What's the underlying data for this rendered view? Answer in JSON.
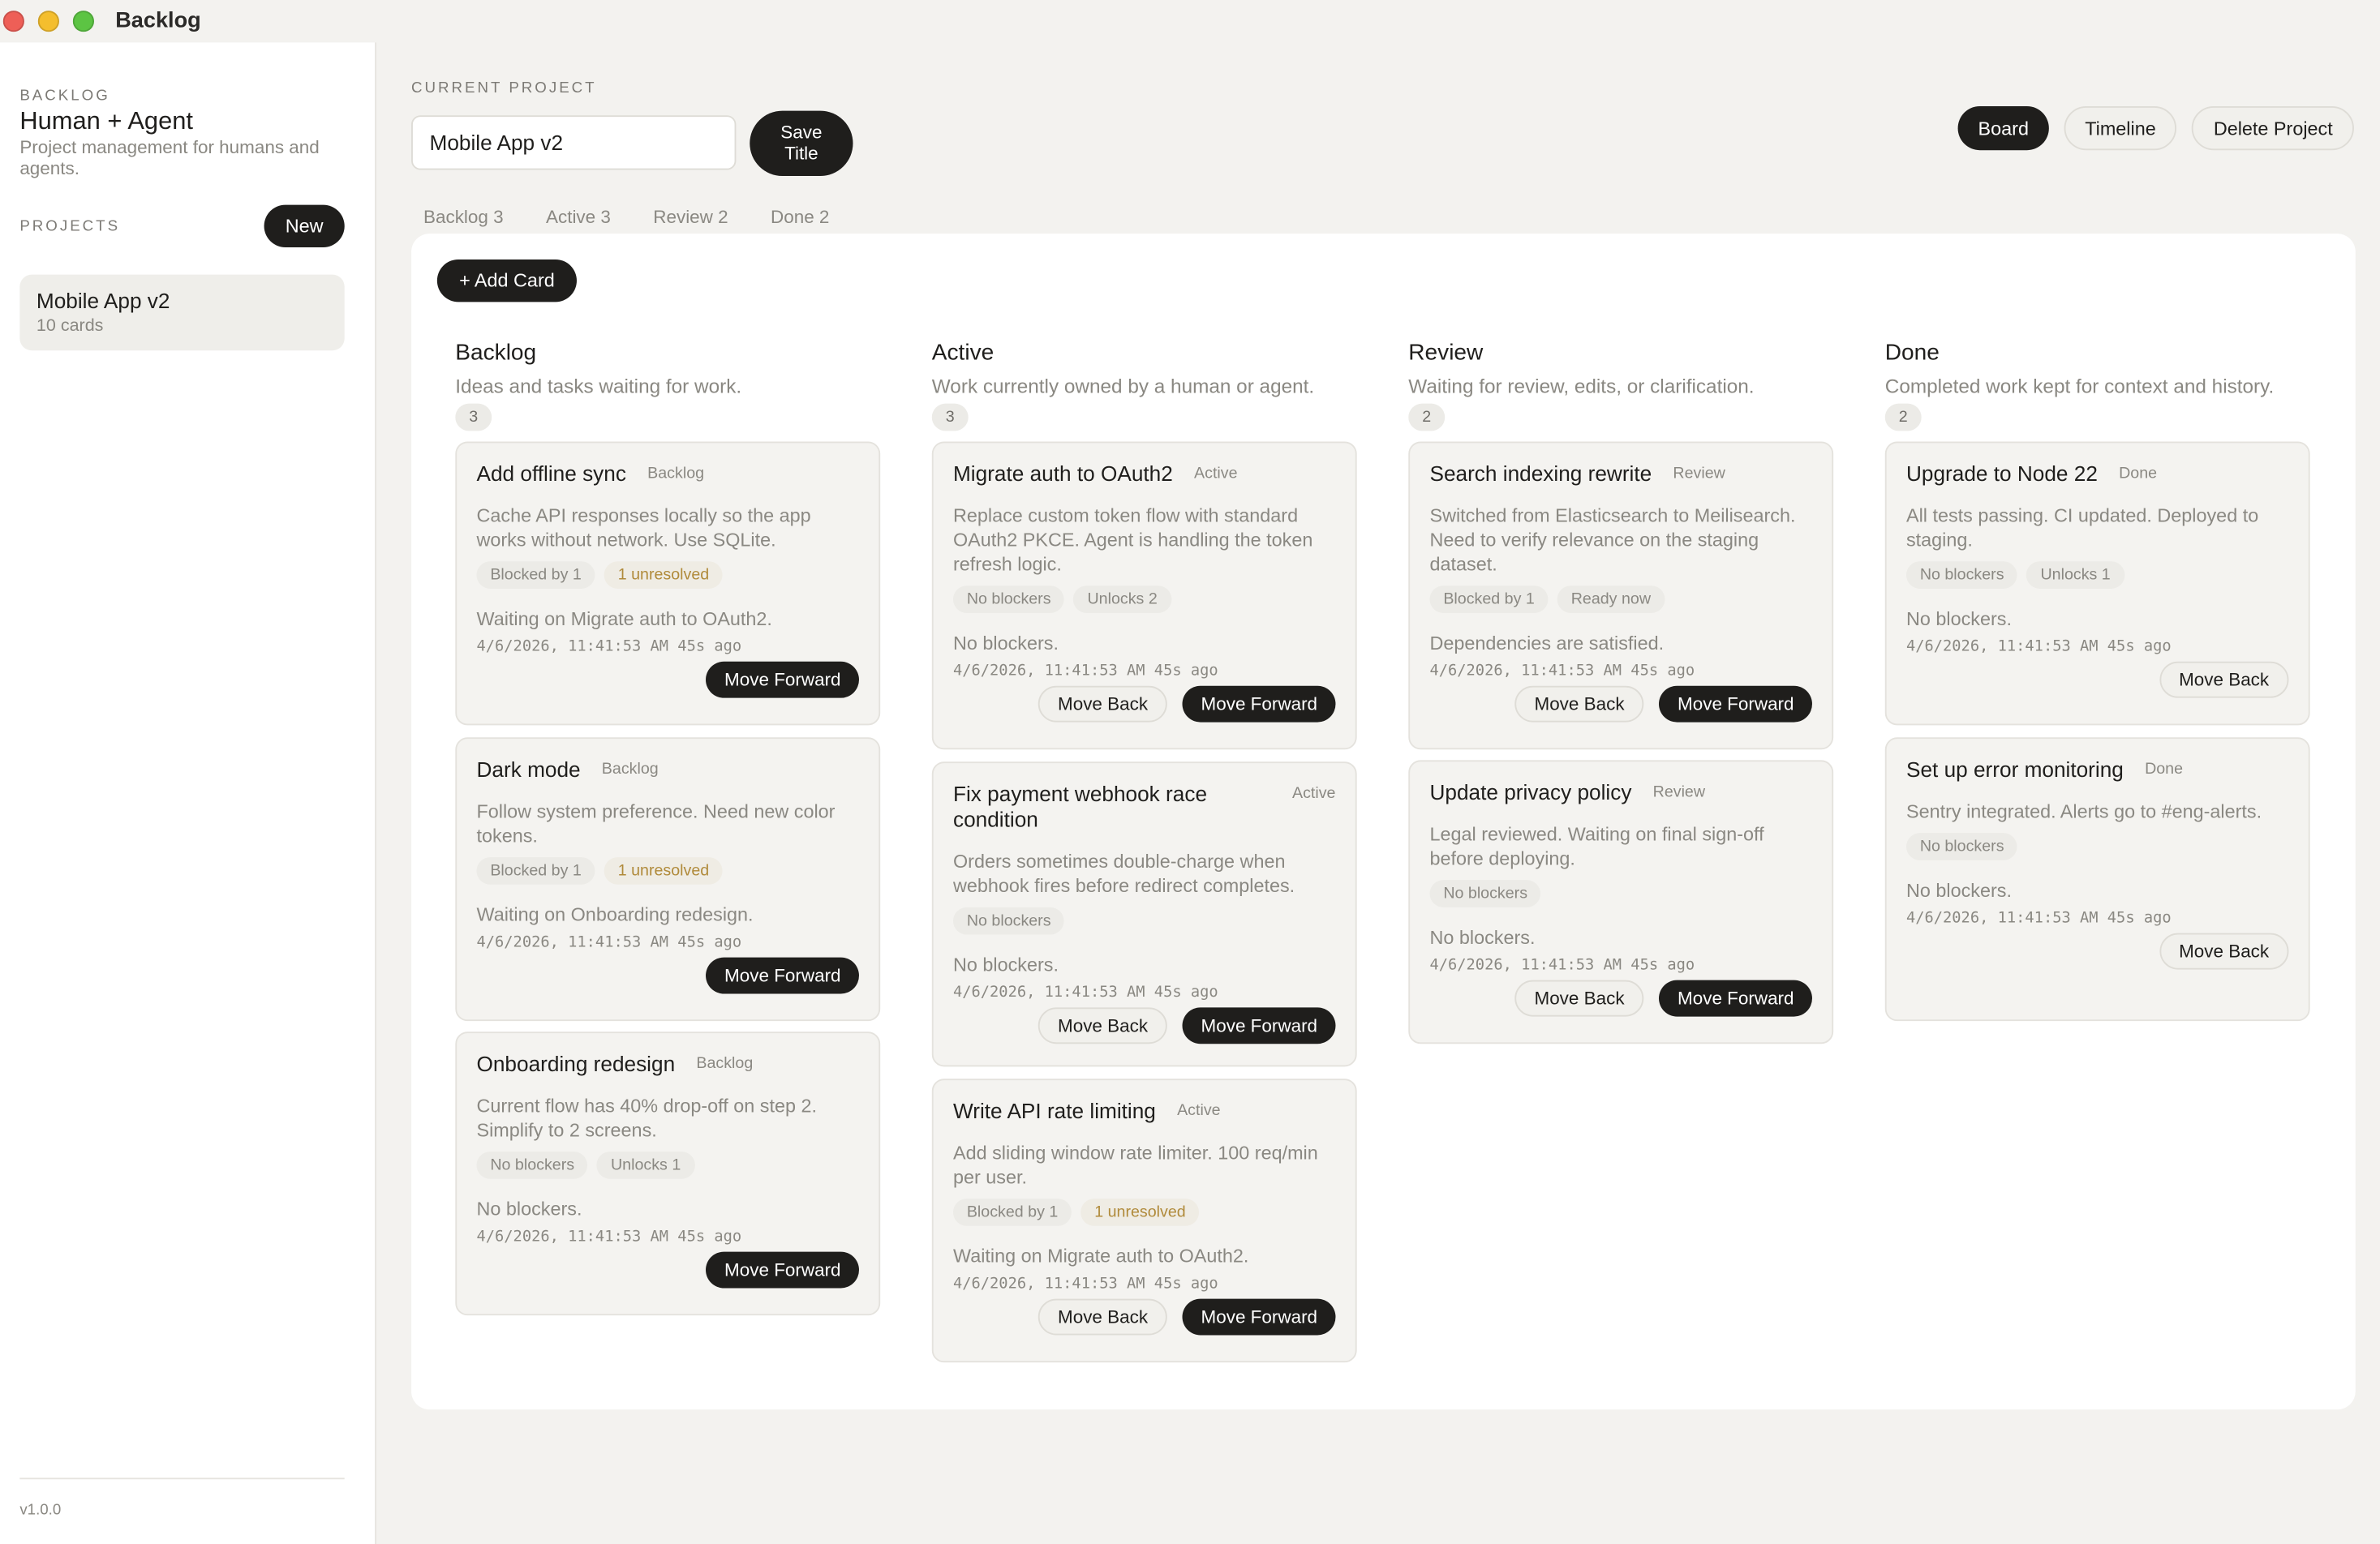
{
  "window": {
    "title": "Backlog"
  },
  "sidebar": {
    "kicker": "BACKLOG",
    "app_name": "Human + Agent",
    "description": "Project management for humans and agents.",
    "projects_label": "PROJECTS",
    "new_label": "New",
    "projects": [
      {
        "name": "Mobile App v2",
        "count": "10 cards"
      }
    ],
    "version": "v1.0.0"
  },
  "header": {
    "current_project_label": "CURRENT PROJECT",
    "title_value": "Mobile App v2",
    "save_label": "Save Title",
    "view_buttons": {
      "board": "Board",
      "timeline": "Timeline",
      "delete": "Delete Project"
    }
  },
  "tabs": [
    {
      "label": "Backlog 3"
    },
    {
      "label": "Active 3"
    },
    {
      "label": "Review 2"
    },
    {
      "label": "Done 2"
    }
  ],
  "board": {
    "add_card_label": "+ Add Card",
    "columns": [
      {
        "title": "Backlog",
        "description": "Ideas and tasks waiting for work.",
        "count": "3",
        "cards": [
          {
            "title": "Add offline sync",
            "status": "Backlog",
            "body": "Cache API responses locally so the app works without network. Use SQLite.",
            "badges": [
              "Blocked by 1",
              "1 unresolved"
            ],
            "note": "Waiting on Migrate auth to OAuth2.",
            "meta": "4/6/2026, 11:41:53 AM  45s ago",
            "forward": "Move Forward"
          },
          {
            "title": "Dark mode",
            "status": "Backlog",
            "body": "Follow system preference. Need new color tokens.",
            "badges": [
              "Blocked by 1",
              "1 unresolved"
            ],
            "note": "Waiting on Onboarding redesign.",
            "meta": "4/6/2026, 11:41:53 AM  45s ago",
            "forward": "Move Forward"
          },
          {
            "title": "Onboarding redesign",
            "status": "Backlog",
            "body": "Current flow has 40% drop-off on step 2. Simplify to 2 screens.",
            "badges": [
              "No blockers",
              "Unlocks 1"
            ],
            "note": "No blockers.",
            "meta": "4/6/2026, 11:41:53 AM  45s ago",
            "forward": "Move Forward"
          }
        ]
      },
      {
        "title": "Active",
        "description": "Work currently owned by a human or agent.",
        "count": "3",
        "cards": [
          {
            "title": "Migrate auth to OAuth2",
            "status": "Active",
            "body": "Replace custom token flow with standard OAuth2 PKCE. Agent is handling the token refresh logic.",
            "badges": [
              "No blockers",
              "Unlocks 2"
            ],
            "note": "No blockers.",
            "meta": "4/6/2026, 11:41:53 AM  45s ago",
            "back": "Move Back",
            "forward": "Move Forward"
          },
          {
            "title": "Fix payment webhook race condition",
            "status": "Active",
            "body": "Orders sometimes double-charge when webhook fires before redirect completes.",
            "badges": [
              "No blockers"
            ],
            "note": "No blockers.",
            "meta": "4/6/2026, 11:41:53 AM  45s ago",
            "back": "Move Back",
            "forward": "Move Forward"
          },
          {
            "title": "Write API rate limiting",
            "status": "Active",
            "body": "Add sliding window rate limiter. 100 req/min per user.",
            "badges": [
              "Blocked by 1",
              "1 unresolved"
            ],
            "note": "Waiting on Migrate auth to OAuth2.",
            "meta": "4/6/2026, 11:41:53 AM  45s ago",
            "back": "Move Back",
            "forward": "Move Forward"
          }
        ]
      },
      {
        "title": "Review",
        "description": "Waiting for review, edits, or clarification.",
        "count": "2",
        "cards": [
          {
            "title": "Search indexing rewrite",
            "status": "Review",
            "body": "Switched from Elasticsearch to Meilisearch. Need to verify relevance on the staging dataset.",
            "badges": [
              "Blocked by 1",
              "Ready now"
            ],
            "note": "Dependencies are satisfied.",
            "meta": "4/6/2026, 11:41:53 AM  45s ago",
            "back": "Move Back",
            "forward": "Move Forward"
          },
          {
            "title": "Update privacy policy",
            "status": "Review",
            "body": "Legal reviewed. Waiting on final sign-off before deploying.",
            "badges": [
              "No blockers"
            ],
            "note": "No blockers.",
            "meta": "4/6/2026, 11:41:53 AM  45s ago",
            "back": "Move Back",
            "forward": "Move Forward"
          }
        ]
      },
      {
        "title": "Done",
        "description": "Completed work kept for context and history.",
        "count": "2",
        "cards": [
          {
            "title": "Upgrade to Node 22",
            "status": "Done",
            "body": "All tests passing. CI updated. Deployed to staging.",
            "badges": [
              "No blockers",
              "Unlocks 1"
            ],
            "note": "No blockers.",
            "meta": "4/6/2026, 11:41:53 AM  45s ago",
            "back": "Move Back"
          },
          {
            "title": "Set up error monitoring",
            "status": "Done",
            "body": "Sentry integrated. Alerts go to #eng-alerts.",
            "badges": [
              "No blockers"
            ],
            "note": "No blockers.",
            "meta": "4/6/2026, 11:41:53 AM  45s ago",
            "back": "Move Back"
          }
        ]
      }
    ]
  }
}
